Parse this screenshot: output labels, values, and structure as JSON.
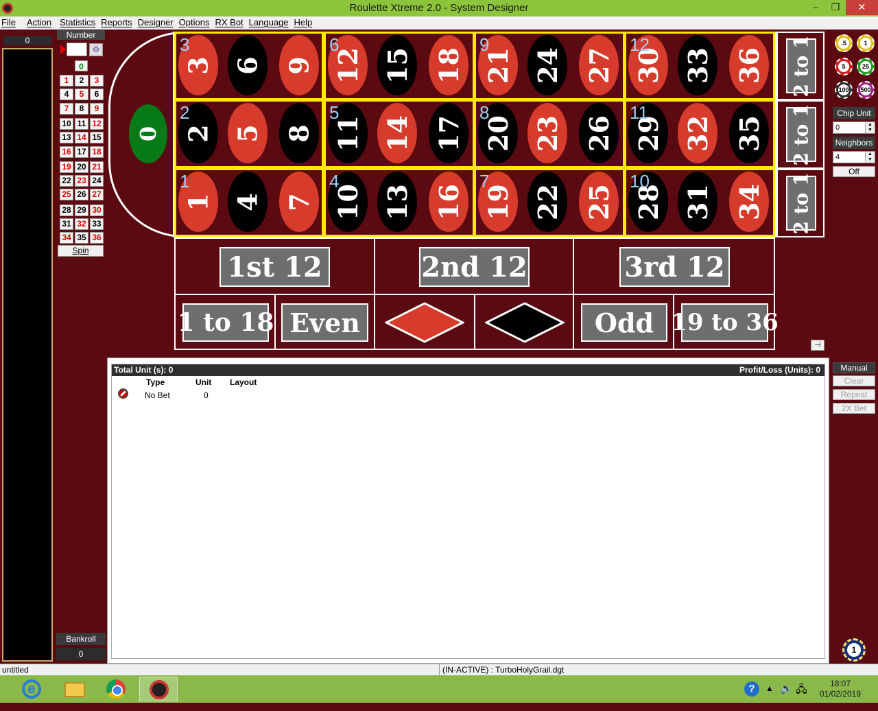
{
  "window": {
    "title": "Roulette Xtreme 2.0 - System Designer",
    "controls": {
      "minimize": "–",
      "maximize": "❐",
      "close": "✕"
    }
  },
  "menu": [
    "File",
    "Action",
    "Statistics",
    "Reports",
    "Designer",
    "Options",
    "RX Bot",
    "Language",
    "Help"
  ],
  "history": {
    "count": "0"
  },
  "number_panel": {
    "header": "Number",
    "zero": "0",
    "grid": [
      [
        {
          "n": "1",
          "c": "red"
        },
        {
          "n": "2",
          "c": "black"
        },
        {
          "n": "3",
          "c": "red"
        }
      ],
      [
        {
          "n": "4",
          "c": "black"
        },
        {
          "n": "5",
          "c": "red"
        },
        {
          "n": "6",
          "c": "black"
        }
      ],
      [
        {
          "n": "7",
          "c": "red"
        },
        {
          "n": "8",
          "c": "black"
        },
        {
          "n": "9",
          "c": "red"
        }
      ],
      [
        {
          "n": "10",
          "c": "black"
        },
        {
          "n": "11",
          "c": "black"
        },
        {
          "n": "12",
          "c": "red"
        }
      ],
      [
        {
          "n": "13",
          "c": "black"
        },
        {
          "n": "14",
          "c": "red"
        },
        {
          "n": "15",
          "c": "black"
        }
      ],
      [
        {
          "n": "16",
          "c": "red"
        },
        {
          "n": "17",
          "c": "black"
        },
        {
          "n": "18",
          "c": "red"
        }
      ],
      [
        {
          "n": "19",
          "c": "red"
        },
        {
          "n": "20",
          "c": "black"
        },
        {
          "n": "21",
          "c": "red"
        }
      ],
      [
        {
          "n": "22",
          "c": "black"
        },
        {
          "n": "23",
          "c": "red"
        },
        {
          "n": "24",
          "c": "black"
        }
      ],
      [
        {
          "n": "25",
          "c": "red"
        },
        {
          "n": "26",
          "c": "black"
        },
        {
          "n": "27",
          "c": "red"
        }
      ],
      [
        {
          "n": "28",
          "c": "black"
        },
        {
          "n": "29",
          "c": "black"
        },
        {
          "n": "30",
          "c": "red"
        }
      ],
      [
        {
          "n": "31",
          "c": "black"
        },
        {
          "n": "32",
          "c": "red"
        },
        {
          "n": "33",
          "c": "black"
        }
      ],
      [
        {
          "n": "34",
          "c": "red"
        },
        {
          "n": "35",
          "c": "black"
        },
        {
          "n": "36",
          "c": "red"
        }
      ]
    ],
    "spin_label": "Spin",
    "bankroll_label": "Bankroll",
    "bankroll_value": "0"
  },
  "table": {
    "zero": "0",
    "top_row": [
      {
        "n": "3",
        "c": "red"
      },
      {
        "n": "6",
        "c": "black"
      },
      {
        "n": "9",
        "c": "red"
      },
      {
        "n": "12",
        "c": "red"
      },
      {
        "n": "15",
        "c": "black"
      },
      {
        "n": "18",
        "c": "red"
      },
      {
        "n": "21",
        "c": "red"
      },
      {
        "n": "24",
        "c": "black"
      },
      {
        "n": "27",
        "c": "red"
      },
      {
        "n": "30",
        "c": "red"
      },
      {
        "n": "33",
        "c": "black"
      },
      {
        "n": "36",
        "c": "red"
      }
    ],
    "mid_row": [
      {
        "n": "2",
        "c": "black"
      },
      {
        "n": "5",
        "c": "red"
      },
      {
        "n": "8",
        "c": "black"
      },
      {
        "n": "11",
        "c": "black"
      },
      {
        "n": "14",
        "c": "red"
      },
      {
        "n": "17",
        "c": "black"
      },
      {
        "n": "20",
        "c": "black"
      },
      {
        "n": "23",
        "c": "red"
      },
      {
        "n": "26",
        "c": "black"
      },
      {
        "n": "29",
        "c": "black"
      },
      {
        "n": "32",
        "c": "red"
      },
      {
        "n": "35",
        "c": "black"
      }
    ],
    "bot_row": [
      {
        "n": "1",
        "c": "red"
      },
      {
        "n": "4",
        "c": "black"
      },
      {
        "n": "7",
        "c": "red"
      },
      {
        "n": "10",
        "c": "black"
      },
      {
        "n": "13",
        "c": "black"
      },
      {
        "n": "16",
        "c": "red"
      },
      {
        "n": "19",
        "c": "red"
      },
      {
        "n": "22",
        "c": "black"
      },
      {
        "n": "25",
        "c": "red"
      },
      {
        "n": "28",
        "c": "black"
      },
      {
        "n": "31",
        "c": "black"
      },
      {
        "n": "34",
        "c": "red"
      }
    ],
    "street_labels": {
      "top": [
        "3",
        "6",
        "9",
        "12"
      ],
      "mid": [
        "2",
        "5",
        "8",
        "11"
      ],
      "bot": [
        "1",
        "4",
        "7",
        "10"
      ]
    },
    "column_bets": [
      "2 to 1",
      "2 to 1",
      "2 to 1"
    ],
    "dozens": [
      "1st 12",
      "2nd 12",
      "3rd 12"
    ],
    "even_money": {
      "low": "1 to 18",
      "even": "Even",
      "odd": "Odd",
      "high": "19 to 36"
    },
    "pin_icon": "pin-icon"
  },
  "chips": [
    ".5",
    "1",
    "5",
    "25",
    "100",
    "500"
  ],
  "chip_colors": [
    "#e0c020",
    "#e0c020",
    "#d02020",
    "#20a020",
    "#303030",
    "#a02080"
  ],
  "right_panel": {
    "chip_unit_label": "Chip Unit",
    "chip_unit_value": "0",
    "neighbors_label": "Neighbors",
    "neighbors_value": "4",
    "off_label": "Off",
    "manual_label": "Manual",
    "clear_label": "Clear",
    "repeat_label": "Repeat",
    "double_label": "2X Bet",
    "bottom_chip": "1"
  },
  "bets": {
    "total_label": "Total Unit (s):  0",
    "profit_label": "Profit/Loss (Units):  0",
    "columns": [
      "Type",
      "Unit",
      "Layout"
    ],
    "row": {
      "type": "No Bet",
      "unit": "0",
      "layout": ""
    }
  },
  "status": {
    "left": "untitled",
    "middle": "(IN-ACTIVE) : TurboHolyGrail.dgt"
  },
  "taskbar": {
    "time": "18:07",
    "date": "01/02/2019"
  }
}
